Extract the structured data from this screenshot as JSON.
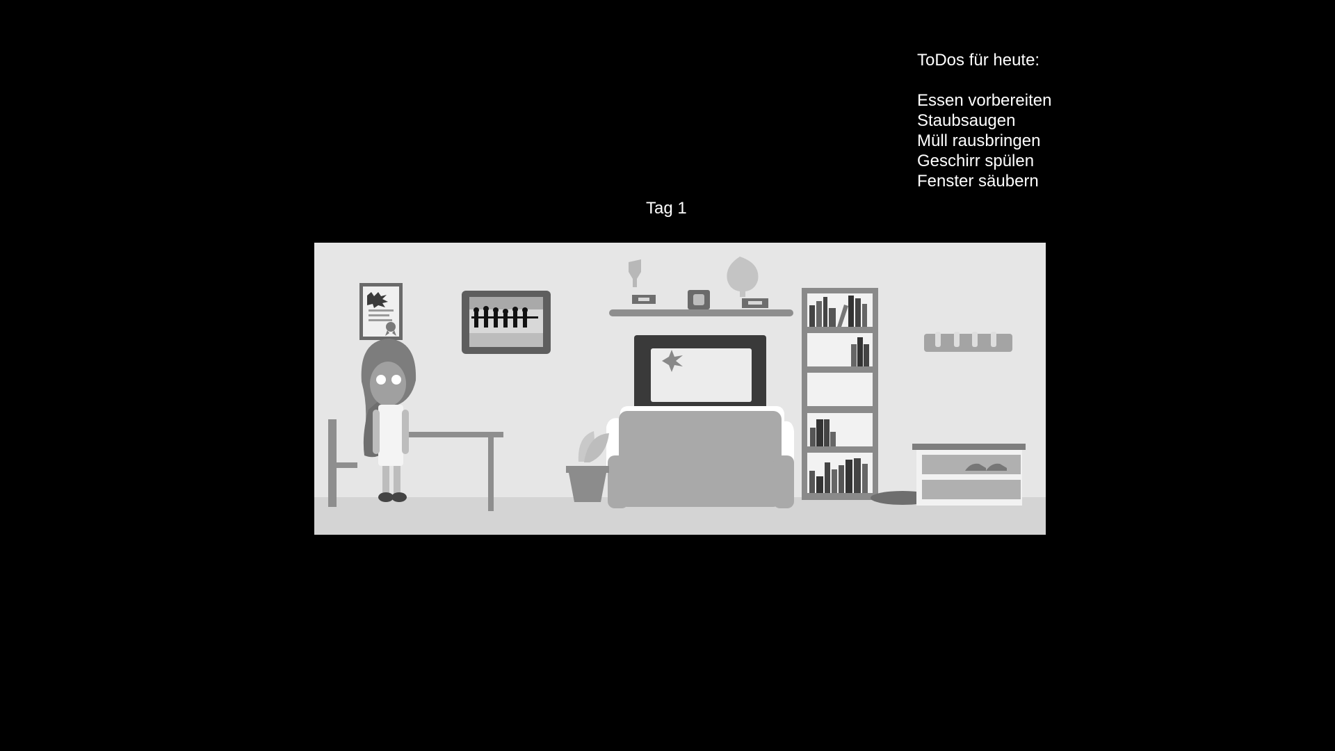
{
  "todo": {
    "heading": "ToDos für heute:",
    "items": [
      "Essen vorbereiten",
      "Staubsaugen",
      "Müll rausbringen",
      "Geschirr spülen",
      "Fenster säubern"
    ]
  },
  "day": {
    "label": "Tag 1"
  },
  "scene": {
    "colors": {
      "background": "#000000",
      "wall": "#e6e6e6",
      "floor": "#d4d4d4",
      "text": "#ffffff"
    }
  }
}
